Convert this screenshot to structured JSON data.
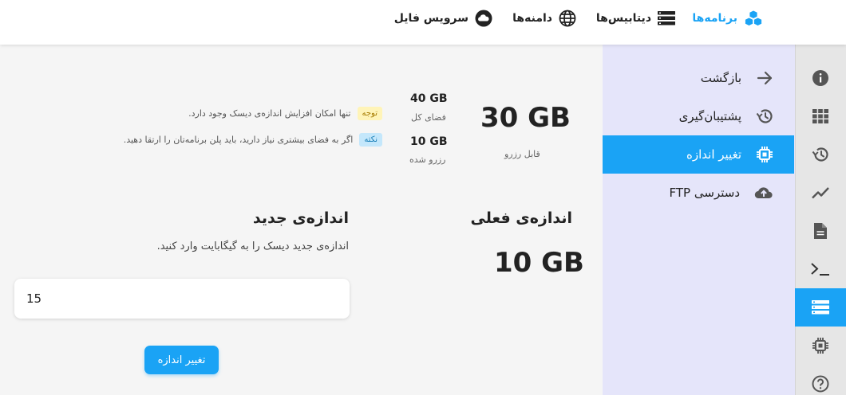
{
  "topnav": {
    "apps": {
      "label": "برنامه‌ها",
      "icon": "cubes-icon"
    },
    "databases": {
      "label": "دیتابیس‌ها",
      "icon": "database-icon"
    },
    "domains": {
      "label": "دامنه‌ها",
      "icon": "globe-icon"
    },
    "file_service": {
      "label": "سرویس فایل",
      "icon": "cloud-icon"
    }
  },
  "rail": {
    "items": [
      {
        "icon": "info-icon"
      },
      {
        "icon": "grid-icon"
      },
      {
        "icon": "history-icon"
      },
      {
        "icon": "chart-icon"
      },
      {
        "icon": "document-icon"
      },
      {
        "icon": "terminal-icon"
      },
      {
        "icon": "storage-icon",
        "active": true
      },
      {
        "icon": "chip-icon"
      },
      {
        "icon": "help-icon"
      }
    ]
  },
  "menu": {
    "items": [
      {
        "label": "بازگشت",
        "icon": "arrow-back-icon"
      },
      {
        "label": "پشتیبان‌گیری",
        "icon": "history-icon"
      },
      {
        "label": "تغییر اندازه",
        "icon": "chip-icon",
        "active": true
      },
      {
        "label": "دسترسی FTP",
        "icon": "cloud-upload-icon"
      }
    ]
  },
  "disk": {
    "available_value": "30 GB",
    "available_label": "قابل رزرو",
    "total_value": "40 GB",
    "total_label": "فضای کل",
    "reserved_value": "10 GB",
    "reserved_label": "رزرو شده"
  },
  "notes": [
    {
      "badge": "توجه",
      "text": "تنها امکان افزایش اندازه‌ی دیسک وجود دارد."
    },
    {
      "badge": "نکته",
      "text": "اگر به فضای بیشتری نیاز دارید، باید پلن برنامه‌تان را ارتقا دهید."
    }
  ],
  "current_size": {
    "title": "اندازه‌ی فعلی",
    "value": "10 GB"
  },
  "new_size": {
    "title": "اندازه‌ی جدید",
    "description": "اندازه‌ی جدید دیسک را به گیگابایت وارد کنید.",
    "input_value": "15",
    "button_label": "تغییر اندازه"
  },
  "colors": {
    "accent": "#1aa3f5",
    "menu_bg": "#e5e5fa",
    "rail_bg": "#e6e6e6",
    "warn_badge_bg": "#fff4b8",
    "info_badge_bg": "#c4e7fb"
  }
}
